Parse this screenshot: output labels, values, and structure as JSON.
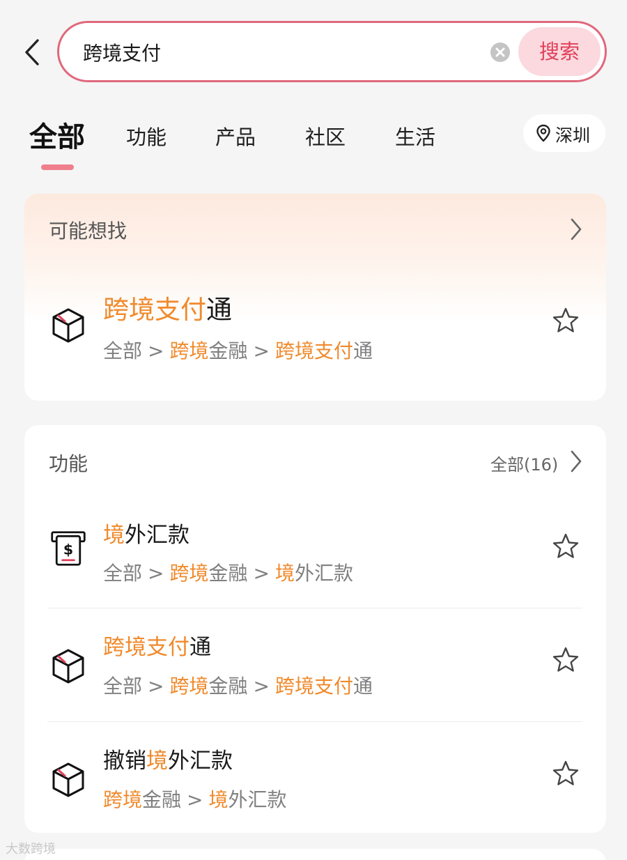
{
  "search": {
    "query": "跨境支付",
    "button_label": "搜索"
  },
  "tabs": [
    {
      "label": "全部",
      "active": true
    },
    {
      "label": "功能",
      "active": false
    },
    {
      "label": "产品",
      "active": false
    },
    {
      "label": "社区",
      "active": false
    },
    {
      "label": "生活",
      "active": false
    }
  ],
  "location": {
    "label": "深圳",
    "icon": "location-pin-icon"
  },
  "suggest_card": {
    "title": "可能想找",
    "item": {
      "title": [
        {
          "t": "跨境支付",
          "hl": true
        },
        {
          "t": "通",
          "hl": false
        }
      ],
      "path": [
        [
          {
            "t": "全部",
            "hl": false
          }
        ],
        [
          {
            "t": "跨境",
            "hl": true
          },
          {
            "t": "金融",
            "hl": false
          }
        ],
        [
          {
            "t": "跨境支付",
            "hl": true
          },
          {
            "t": "通",
            "hl": false
          }
        ]
      ],
      "icon": "package-box-icon"
    }
  },
  "function_card": {
    "title": "功能",
    "more_label": "全部(16)",
    "items": [
      {
        "title": [
          {
            "t": "境",
            "hl": true
          },
          {
            "t": "外汇款",
            "hl": false
          }
        ],
        "path": [
          [
            {
              "t": "全部",
              "hl": false
            }
          ],
          [
            {
              "t": "跨境",
              "hl": true
            },
            {
              "t": "金融",
              "hl": false
            }
          ],
          [
            {
              "t": "境",
              "hl": true
            },
            {
              "t": "外汇款",
              "hl": false
            }
          ]
        ],
        "icon": "dollar-remittance-icon"
      },
      {
        "title": [
          {
            "t": "跨境支付",
            "hl": true
          },
          {
            "t": "通",
            "hl": false
          }
        ],
        "path": [
          [
            {
              "t": "全部",
              "hl": false
            }
          ],
          [
            {
              "t": "跨境",
              "hl": true
            },
            {
              "t": "金融",
              "hl": false
            }
          ],
          [
            {
              "t": "跨境支付",
              "hl": true
            },
            {
              "t": "通",
              "hl": false
            }
          ]
        ],
        "icon": "package-box-icon"
      },
      {
        "title": [
          {
            "t": "撤销",
            "hl": false
          },
          {
            "t": "境",
            "hl": true
          },
          {
            "t": "外汇款",
            "hl": false
          }
        ],
        "path": [
          [
            {
              "t": "跨境",
              "hl": true
            },
            {
              "t": "金融",
              "hl": false
            }
          ],
          [
            {
              "t": "境",
              "hl": true
            },
            {
              "t": "外汇款",
              "hl": false
            }
          ]
        ],
        "icon": "package-box-icon"
      }
    ]
  },
  "path_separator": ">",
  "watermark": "大数跨境",
  "colors": {
    "accent": "#e0687c",
    "highlight": "#f08a2c",
    "search_button_bg": "#fbd9de",
    "search_button_text": "#e0405a",
    "tab_indicator": "#ef7f8d"
  }
}
